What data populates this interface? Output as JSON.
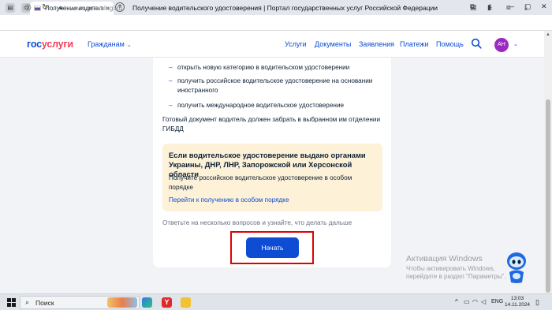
{
  "browser": {
    "tab_title": "Получение водительск",
    "tab_close": "×",
    "new_tab": "+",
    "url_host": "www.gosuslugi.ru",
    "page_title": "Получение водительского удостоверения | Портал государственных услуг Российской Федерации"
  },
  "header": {
    "logo_part1": "гос",
    "logo_part2": "услуги",
    "citizens_label": "Гражданам",
    "nav": [
      "Услуги",
      "Документы",
      "Заявления",
      "Платежи",
      "Помощь"
    ],
    "avatar_initials": "АН"
  },
  "content": {
    "bullets": [
      "открыть новую категорию в водительском удостоверении",
      "получить российское водительское удостоверение на основании иностранного",
      "получить международное водительское удостоверение"
    ],
    "bullet_dash": "–",
    "paragraph": "Готовый документ водитель должен забрать в выбранном им отделении ГИБДД",
    "notice": {
      "title": "Если водительское удостоверение выдано органами Украины, ДНР, ЛНР, Запорожской или Херсонской области",
      "text": "Получите российское водительское удостоверение в особом порядке",
      "link": "Перейти к получению в особом порядке"
    },
    "hint": "Ответьте на несколько вопросов и узнайте, что делать дальше",
    "start_button": "Начать"
  },
  "watermark": {
    "title": "Активация Windows",
    "text": "Чтобы активировать Windows, перейдите в раздел \"Параметры\"."
  },
  "taskbar": {
    "search_label": "Поиск",
    "lang": "ENG",
    "time": "13:03",
    "date": "14.11.2024"
  },
  "colors": {
    "brand_blue": "#0d4cd3",
    "brand_red": "#ee3f58",
    "notice_bg": "#fdf1d8",
    "highlight_red": "#e00000",
    "avatar": "#9b2bbf"
  }
}
